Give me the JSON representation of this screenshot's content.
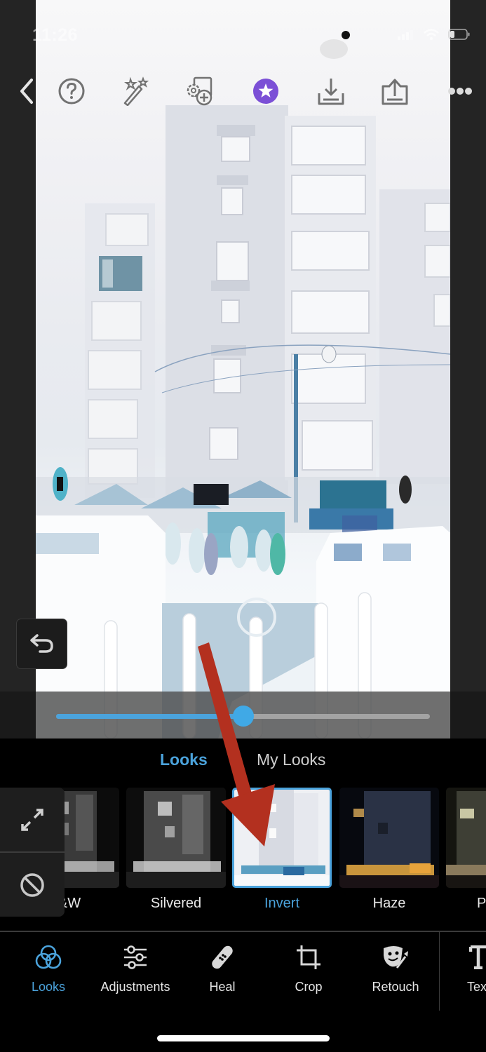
{
  "status_bar": {
    "time": "11:26"
  },
  "top_toolbar": {
    "buttons": [
      {
        "name": "back",
        "icon": "chevron-left-icon"
      },
      {
        "name": "help",
        "icon": "question-circle-icon"
      },
      {
        "name": "auto-fix",
        "icon": "magic-wand-icon"
      },
      {
        "name": "add-to-collage",
        "icon": "gear-stack-plus-icon"
      },
      {
        "name": "premium",
        "icon": "star-badge-icon"
      },
      {
        "name": "download",
        "icon": "download-tray-icon"
      },
      {
        "name": "share",
        "icon": "share-tray-icon"
      },
      {
        "name": "more",
        "icon": "more-dots-icon"
      }
    ]
  },
  "editor": {
    "undo_icon": "undo-arrow-icon",
    "intensity_slider": {
      "value_percent": 50
    }
  },
  "looks_panel": {
    "tabs": [
      {
        "label": "Looks",
        "active": true
      },
      {
        "label": "My Looks",
        "active": false
      }
    ],
    "side_buttons": [
      {
        "name": "expand",
        "icon": "expand-arrows-icon"
      },
      {
        "name": "none",
        "icon": "no-entry-icon"
      }
    ],
    "presets": [
      {
        "label": "B&W",
        "visible_label": "&W",
        "selected": false,
        "style": "bw"
      },
      {
        "label": "Silvered",
        "selected": false,
        "style": "silvered"
      },
      {
        "label": "Invert",
        "selected": true,
        "style": "invert"
      },
      {
        "label": "Haze",
        "selected": false,
        "style": "haze"
      },
      {
        "label": "P",
        "selected": false,
        "style": "partial"
      }
    ]
  },
  "bottom_nav": {
    "items": [
      {
        "label": "Looks",
        "icon": "overlapping-circles-icon",
        "active": true
      },
      {
        "label": "Adjustments",
        "icon": "sliders-icon",
        "active": false
      },
      {
        "label": "Heal",
        "icon": "bandage-icon",
        "active": false
      },
      {
        "label": "Crop",
        "icon": "crop-icon",
        "active": false
      },
      {
        "label": "Retouch",
        "icon": "face-brush-icon",
        "active": false
      },
      {
        "label": "Tex",
        "icon": "text-icon",
        "active": false
      }
    ]
  },
  "colors": {
    "accent": "#4ba3dc",
    "premium": "#7b4fd6",
    "annotation_arrow": "#b3301f",
    "background": "#000000"
  }
}
